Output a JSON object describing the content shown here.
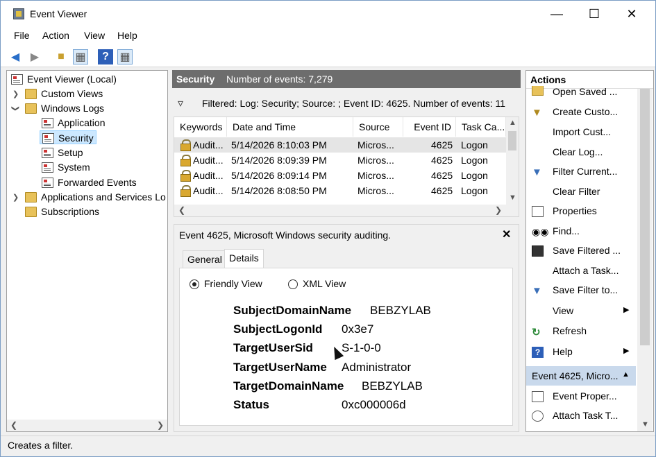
{
  "window": {
    "title": "Event Viewer"
  },
  "menu": [
    "File",
    "Action",
    "View",
    "Help"
  ],
  "tree": {
    "root": "Event Viewer (Local)",
    "custom_views": "Custom Views",
    "windows_logs": "Windows Logs",
    "logs": [
      "Application",
      "Security",
      "Setup",
      "System",
      "Forwarded Events"
    ],
    "apps_services": "Applications and Services Lo",
    "subscriptions": "Subscriptions"
  },
  "log_header": {
    "name": "Security",
    "count": "Number of events: 7,279"
  },
  "filter_text": "Filtered: Log: Security; Source: ; Event ID: 4625. Number of events: 11",
  "grid": {
    "columns": [
      "Keywords",
      "Date and Time",
      "Source",
      "Event ID",
      "Task Ca..."
    ],
    "rows": [
      [
        "Audit...",
        "5/14/2026 8:10:03 PM",
        "Micros...",
        "4625",
        "Logon"
      ],
      [
        "Audit...",
        "5/14/2026 8:09:39 PM",
        "Micros...",
        "4625",
        "Logon"
      ],
      [
        "Audit...",
        "5/14/2026 8:09:14 PM",
        "Micros...",
        "4625",
        "Logon"
      ],
      [
        "Audit...",
        "5/14/2026 8:08:50 PM",
        "Micros...",
        "4625",
        "Logon"
      ]
    ]
  },
  "detail": {
    "title": "Event 4625, Microsoft Windows security auditing.",
    "tabs": [
      "General",
      "Details"
    ],
    "view_options": [
      "Friendly View",
      "XML View"
    ],
    "fields": [
      {
        "key": "SubjectDomainName",
        "value": "BEBZYLAB"
      },
      {
        "key": "SubjectLogonId",
        "value": "0x3e7"
      },
      {
        "key": "TargetUserSid",
        "value": "S-1-0-0"
      },
      {
        "key": "TargetUserName",
        "value": "Administrator"
      },
      {
        "key": "TargetDomainName",
        "value": "BEBZYLAB"
      },
      {
        "key": "Status",
        "value": "0xc000006d"
      }
    ]
  },
  "actions": {
    "header": "Actions",
    "items": [
      "Open Saved ...",
      "Create Custo...",
      "Import Cust...",
      "Clear Log...",
      "Filter Current...",
      "Clear Filter",
      "Properties",
      "Find...",
      "Save Filtered ...",
      "Attach a Task...",
      "Save Filter to...",
      "View",
      "Refresh",
      "Help"
    ],
    "section2": "Event 4625, Micro...",
    "items2": [
      "Event Proper...",
      "Attach Task T..."
    ]
  },
  "status": "Creates a filter."
}
